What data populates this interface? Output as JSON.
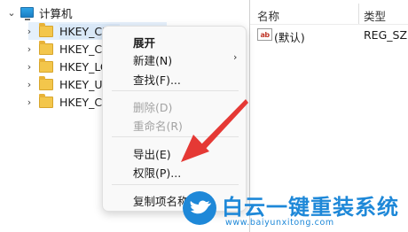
{
  "tree": {
    "root_label": "计算机",
    "items": [
      {
        "label": "HKEY_CLA"
      },
      {
        "label": "HKEY_CU"
      },
      {
        "label": "HKEY_LOC"
      },
      {
        "label": "HKEY_US"
      },
      {
        "label": "HKEY_CU"
      }
    ]
  },
  "list": {
    "columns": {
      "name": "名称",
      "type": "类型"
    },
    "rows": [
      {
        "icon": "ab",
        "name": "(默认)",
        "type": "REG_SZ"
      }
    ]
  },
  "context_menu": {
    "items": [
      {
        "label": "展开",
        "bold": true,
        "enabled": true
      },
      {
        "label": "新建(N)",
        "submenu": true,
        "enabled": true
      },
      {
        "label": "查找(F)...",
        "enabled": true
      },
      {
        "label": "删除(D)",
        "enabled": false
      },
      {
        "label": "重命名(R)",
        "enabled": false
      },
      {
        "label": "导出(E)",
        "enabled": true
      },
      {
        "label": "权限(P)...",
        "enabled": true
      },
      {
        "label": "复制项名称",
        "enabled": true
      }
    ]
  },
  "watermark": {
    "title": "白云一键重装系统",
    "url": "www.baiyunxitong.com",
    "color": "#1e88d8"
  },
  "annotation_color": "#e53935"
}
